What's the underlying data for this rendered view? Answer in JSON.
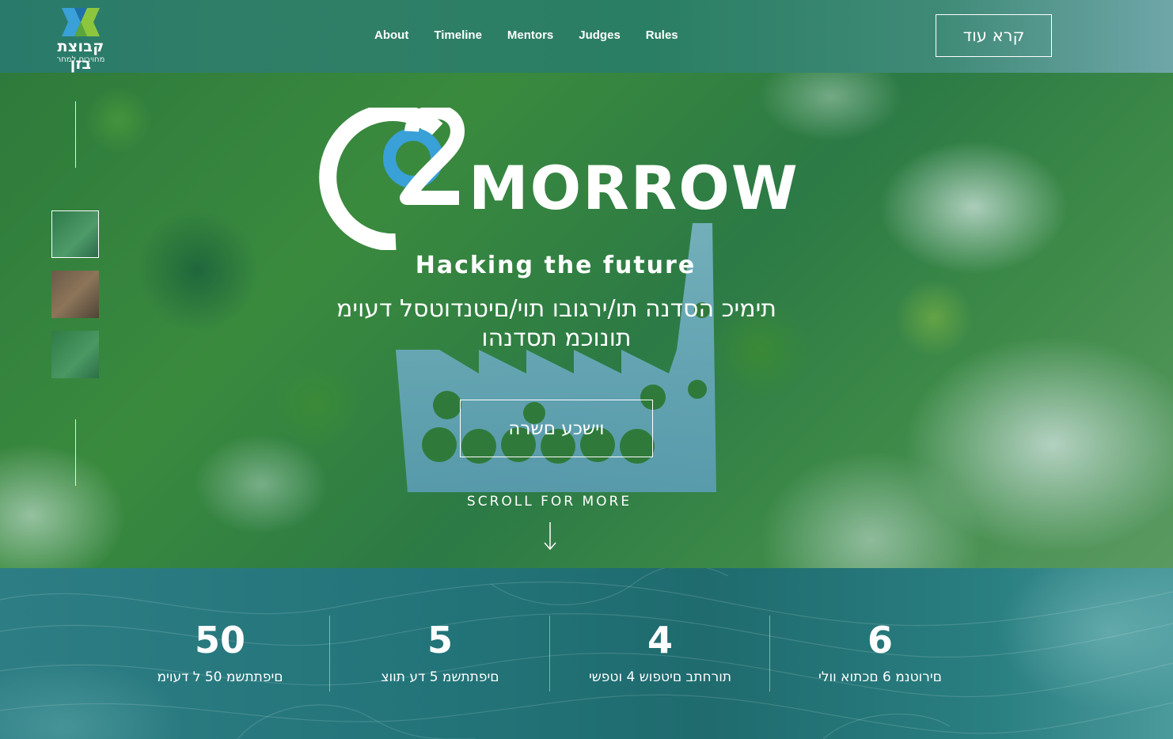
{
  "brand": {
    "name": "קבוצת בזן",
    "tagline": "מחויבים למחר"
  },
  "nav": {
    "items": [
      {
        "label": "About"
      },
      {
        "label": "Timeline"
      },
      {
        "label": "Mentors"
      },
      {
        "label": "Judges"
      },
      {
        "label": "Rules"
      }
    ]
  },
  "header": {
    "cta_label": "קרא עוד"
  },
  "hero": {
    "logo_text": "MORROW",
    "tagline": "Hacking the future",
    "subtitle": "תימיכ הסדנה תו/ירגובו תוי/םיטנדוטסל דעוימ תונוכמ תסדנהו",
    "register_label": "וישכע םשרה",
    "scroll_label": "SCROLL FOR MORE"
  },
  "stats": [
    {
      "number": "50",
      "label": "םיפתתשמ 50 ל דעוימ"
    },
    {
      "number": "5",
      "label": "םיפתתשמ 5 דע תווצ"
    },
    {
      "number": "4",
      "label": "תורחתב םיטפוש 4 וטפשי"
    },
    {
      "number": "6",
      "label": "םירוטנמ 6 םכתוא וולי"
    }
  ],
  "colors": {
    "header_bg": "#2f7f67",
    "hero_green": "#2e7a3c",
    "stats_bg": "#23757a",
    "logo_blue": "#3aa0d8",
    "logo_green": "#8cc63f"
  }
}
